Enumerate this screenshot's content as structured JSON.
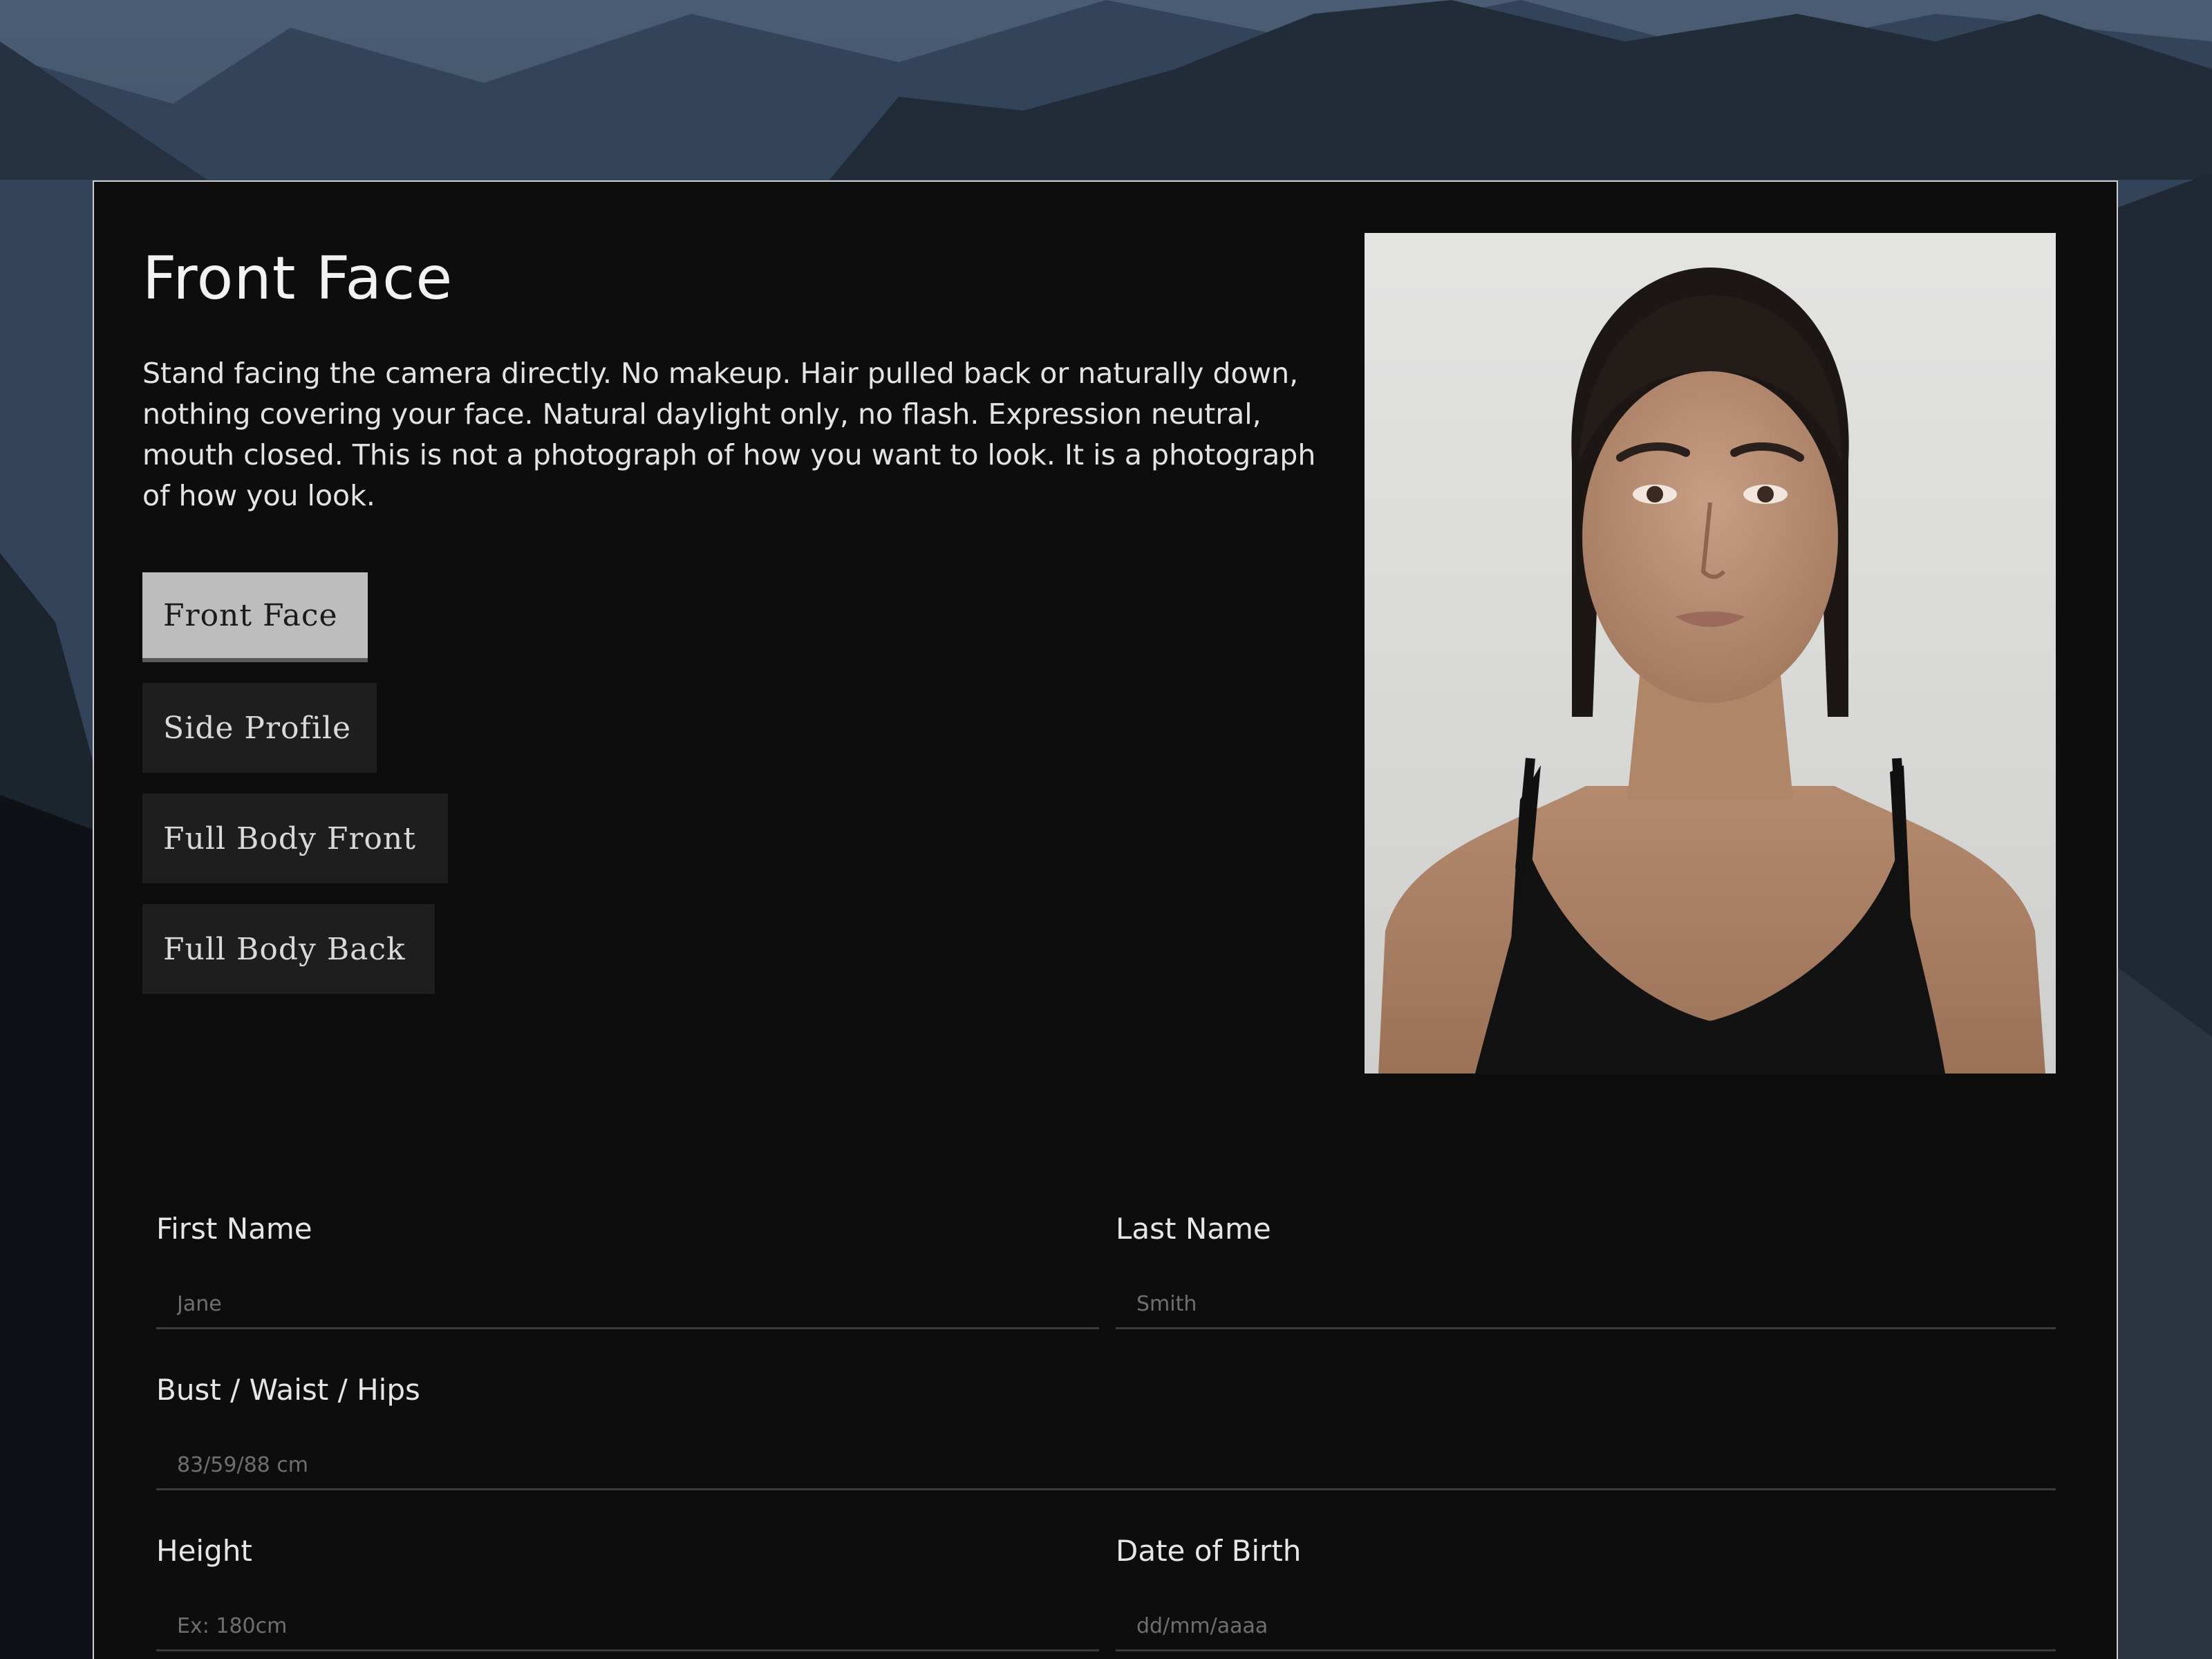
{
  "colors": {
    "panel_bg": "#0d0d0e",
    "panel_border": "#cfcfcf",
    "button_bg": "#1e1e1f",
    "button_active_bg": "#bdbdbd",
    "text": "#e6e6e6"
  },
  "section": {
    "title": "Front Face",
    "description": "Stand facing the camera directly. No makeup. Hair pulled back or naturally down, nothing covering your face. Natural daylight only, no flash. Expression neutral, mouth closed. This is not a photograph of how you want to look. It is a photograph of how you look."
  },
  "poses": [
    {
      "label": "Front Face",
      "active": true
    },
    {
      "label": "Side Profile",
      "active": false
    },
    {
      "label": "Full Body Front",
      "active": false
    },
    {
      "label": "Full Body Back",
      "active": false
    }
  ],
  "form": {
    "first_name": {
      "label": "First Name",
      "placeholder": "Jane"
    },
    "last_name": {
      "label": "Last Name",
      "placeholder": "Smith"
    },
    "measurements": {
      "label": "Bust / Waist / Hips",
      "placeholder": "83/59/88 cm"
    },
    "height": {
      "label": "Height",
      "placeholder": "Ex: 180cm"
    },
    "dob": {
      "label": "Date of Birth",
      "placeholder": "dd/mm/aaaa"
    }
  }
}
